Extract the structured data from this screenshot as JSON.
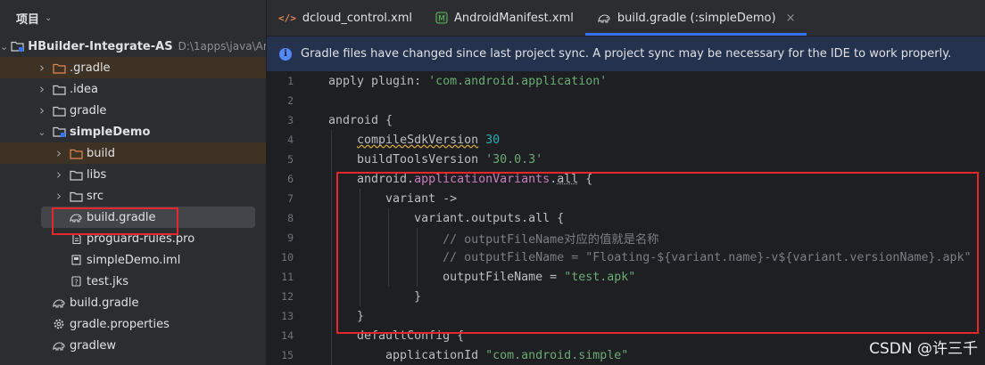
{
  "project_panel": {
    "title": "项目",
    "tree": [
      {
        "label": "HBuilder-Integrate-AS",
        "path": "D:\\1apps\\java\\Ar",
        "icon": "module-folder-icon",
        "arrow": "down",
        "indent": 0,
        "bold": true
      },
      {
        "label": ".gradle",
        "icon": "folder-orange-icon",
        "arrow": "right",
        "indent": 1,
        "excluded": true
      },
      {
        "label": ".idea",
        "icon": "folder-icon",
        "arrow": "right",
        "indent": 1
      },
      {
        "label": "gradle",
        "icon": "folder-icon",
        "arrow": "right",
        "indent": 1
      },
      {
        "label": "simpleDemo",
        "icon": "module-folder-icon",
        "arrow": "down",
        "indent": 1,
        "bold": true
      },
      {
        "label": "build",
        "icon": "folder-orange-icon",
        "arrow": "right",
        "indent": 2,
        "excluded": true
      },
      {
        "label": "libs",
        "icon": "folder-icon",
        "arrow": "right",
        "indent": 2
      },
      {
        "label": "src",
        "icon": "folder-icon",
        "arrow": "right",
        "indent": 2
      },
      {
        "label": "build.gradle",
        "icon": "gradle-elephant-icon",
        "arrow": "none",
        "indent": 2,
        "selected": true
      },
      {
        "label": "proguard-rules.pro",
        "icon": "text-file-icon",
        "arrow": "none",
        "indent": 2
      },
      {
        "label": "simpleDemo.iml",
        "icon": "iml-file-icon",
        "arrow": "none",
        "indent": 2
      },
      {
        "label": "test.jks",
        "icon": "keystore-file-icon",
        "arrow": "none",
        "indent": 2
      },
      {
        "label": "build.gradle",
        "icon": "gradle-elephant-icon",
        "arrow": "none",
        "indent": 1
      },
      {
        "label": "gradle.properties",
        "icon": "gear-file-icon",
        "arrow": "none",
        "indent": 1
      },
      {
        "label": "gradlew",
        "icon": "gradle-elephant-icon",
        "arrow": "none",
        "indent": 1
      }
    ]
  },
  "tabs": [
    {
      "label": "dcloud_control.xml",
      "icon": "xml-file-icon",
      "active": false
    },
    {
      "label": "AndroidManifest.xml",
      "icon": "manifest-file-icon",
      "active": false
    },
    {
      "label": "build.gradle (:simpleDemo)",
      "icon": "gradle-elephant-icon",
      "active": true,
      "close": "×"
    }
  ],
  "banner": {
    "text": "Gradle files have changed since last project sync. A project sync may be necessary for the IDE to work properly."
  },
  "code": {
    "line_numbers": [
      "1",
      "2",
      "3",
      "4",
      "5",
      "6",
      "7",
      "8",
      "9",
      "10",
      "11",
      "12",
      "13",
      "14",
      "15"
    ]
  },
  "watermark": "CSDN @许三千",
  "colors": {
    "accent": "#3574f0",
    "highlight_box": "#e5262b",
    "banner": "#25324d",
    "string": "#6aab73",
    "number": "#2aacb8"
  }
}
